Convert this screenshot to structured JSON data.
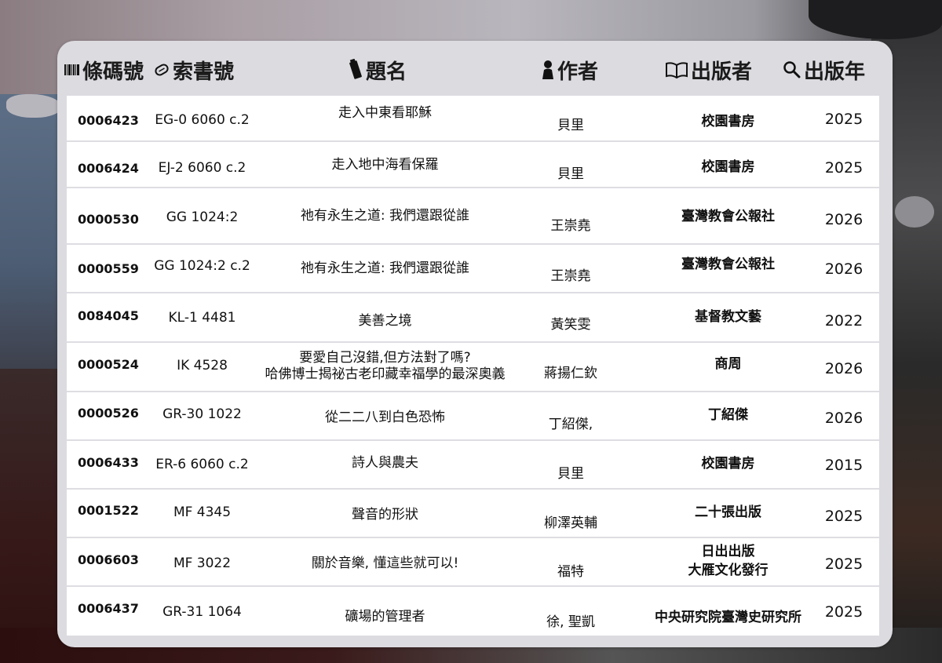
{
  "headers": {
    "barcode": "條碼號",
    "call_number": "索書號",
    "title": "題名",
    "author": "作者",
    "publisher": "出版者",
    "year": "出版年"
  },
  "header_icons": [
    "barcode-icon",
    "tag-icon",
    "bookmark-icon",
    "person-icon",
    "book-icon",
    "search-icon"
  ],
  "rows": [
    {
      "barcode": "0006423",
      "call_number": "EG-0 6060 c.2",
      "title": [
        "走入中東看耶穌"
      ],
      "author": "貝里",
      "publisher": [
        "校園書房"
      ],
      "year": "2025"
    },
    {
      "barcode": "0006424",
      "call_number": "EJ-2 6060 c.2",
      "title": [
        "走入地中海看保羅"
      ],
      "author": "貝里",
      "publisher": [
        "校園書房"
      ],
      "year": "2025"
    },
    {
      "barcode": "0000530",
      "call_number": "GG 1024:2",
      "title": [
        "祂有永生之道: 我們還跟從誰"
      ],
      "author": "王崇堯",
      "publisher": [
        "臺灣教會公報社"
      ],
      "year": "2026"
    },
    {
      "barcode": "0000559",
      "call_number": "GG 1024:2 c.2",
      "title": [
        "祂有永生之道: 我們還跟從誰"
      ],
      "author": "王崇堯",
      "publisher": [
        "臺灣教會公報社"
      ],
      "year": "2026"
    },
    {
      "barcode": "0084045",
      "call_number": "KL-1 4481",
      "title": [
        "美善之境"
      ],
      "author": "黃笑雯",
      "publisher": [
        "基督教文藝"
      ],
      "year": "2022"
    },
    {
      "barcode": "0000524",
      "call_number": "IK 4528",
      "title": [
        "要愛自己沒錯,但方法對了嗎?",
        "哈佛博士揭祕古老印藏幸福學的最深奧義"
      ],
      "author": "蔣揚仁欽",
      "publisher": [
        "商周"
      ],
      "year": "2026"
    },
    {
      "barcode": "0000526",
      "call_number": "GR-30 1022",
      "title": [
        "從二二八到白色恐怖"
      ],
      "author": "丁紹傑,",
      "publisher": [
        "丁紹傑"
      ],
      "year": "2026"
    },
    {
      "barcode": "0006433",
      "call_number": "ER-6 6060 c.2",
      "title": [
        "詩人與農夫"
      ],
      "author": "貝里",
      "publisher": [
        "校園書房"
      ],
      "year": "2015"
    },
    {
      "barcode": "0001522",
      "call_number": "MF 4345",
      "title": [
        "聲音的形狀"
      ],
      "author": "柳澤英輔",
      "publisher": [
        "二十張出版"
      ],
      "year": "2025"
    },
    {
      "barcode": "0006603",
      "call_number": "MF 3022",
      "title": [
        "關於音樂, 懂這些就可以!"
      ],
      "author": "福特",
      "publisher": [
        "日出出版",
        "大雁文化發行"
      ],
      "year": "2025"
    },
    {
      "barcode": "0006437",
      "call_number": "GR-31 1064",
      "title": [
        "礦場的管理者"
      ],
      "author": "徐, 聖凱",
      "publisher": [
        "中央研究院臺灣史研究所"
      ],
      "year": "2025"
    }
  ]
}
